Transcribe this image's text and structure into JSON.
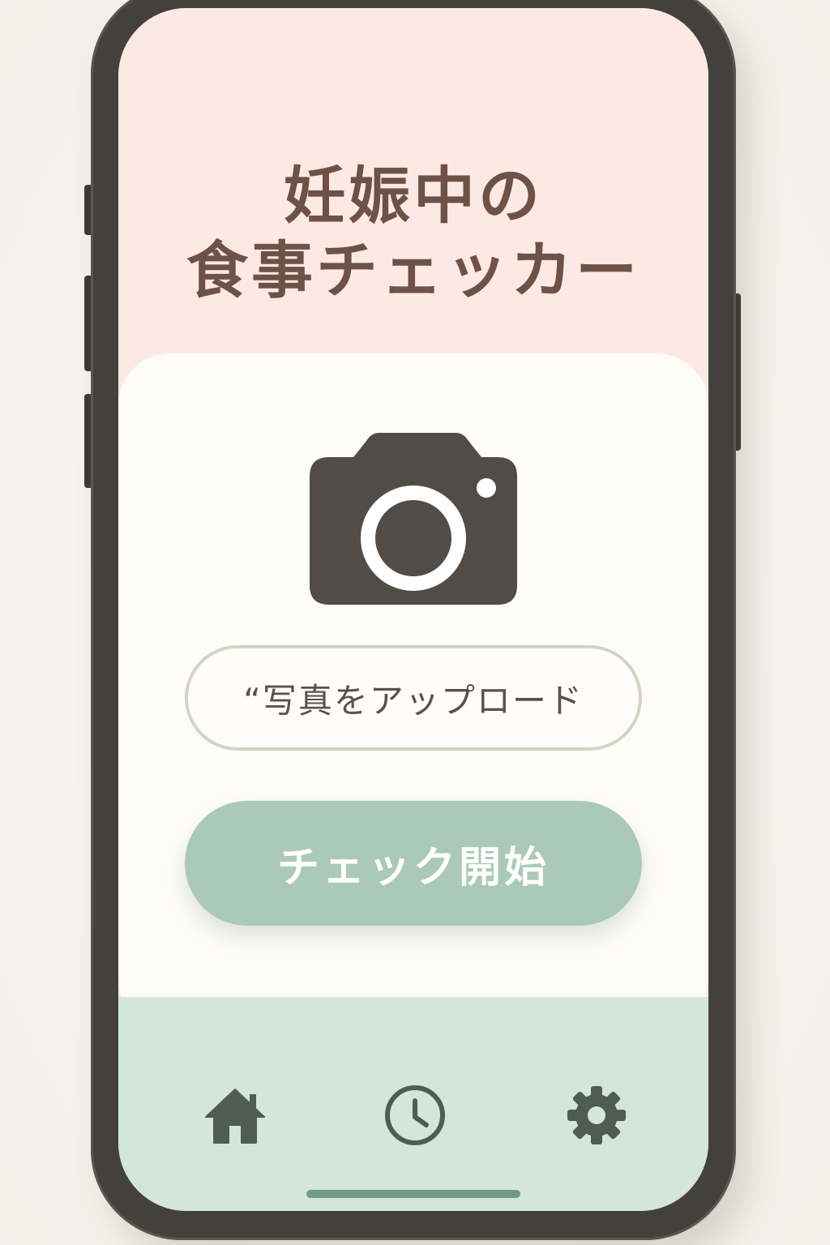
{
  "app": {
    "title_line1": "妊娠中の",
    "title_line2": "食事チェッカー"
  },
  "upload": {
    "icon": "camera-icon",
    "button_label": "“写真をアップロード"
  },
  "actions": {
    "start_label": "チェック開始"
  },
  "nav": {
    "items": [
      {
        "icon": "home-icon",
        "name": "home"
      },
      {
        "icon": "clock-icon",
        "name": "history"
      },
      {
        "icon": "gear-icon",
        "name": "settings"
      }
    ]
  },
  "colors": {
    "header_bg": "#fde9e3",
    "card_bg": "#fdfcf7",
    "accent": "#abc9b8",
    "nav_bg": "#d4e6dc",
    "title_text": "#6e5147",
    "icon": "#524c46"
  }
}
